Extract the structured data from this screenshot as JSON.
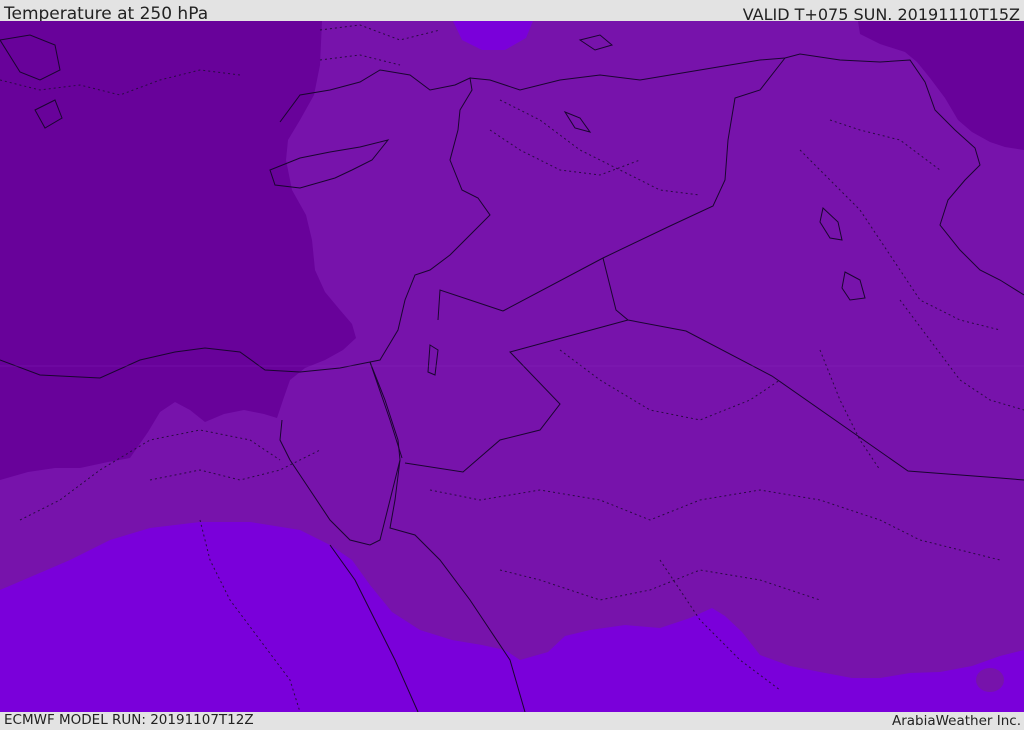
{
  "header": {
    "title": "Temperature at 250 hPa",
    "valid": "VALID T+075 SUN. 20191110T15Z"
  },
  "footer": {
    "model_run": "ECMWF MODEL RUN: 20191107T12Z",
    "credit": "ArabiaWeather Inc."
  },
  "map": {
    "colors": {
      "base_zone": "#7713ab",
      "cold_zone": "#68029a",
      "warm_zone": "#7a00da",
      "border": "#1a0530",
      "admin_border": "#2a0a44"
    }
  }
}
